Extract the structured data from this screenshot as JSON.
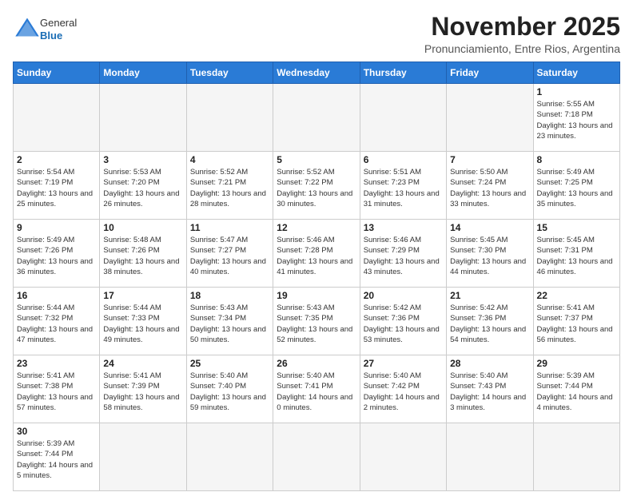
{
  "header": {
    "logo_general": "General",
    "logo_blue": "Blue",
    "month": "November 2025",
    "location": "Pronunciamiento, Entre Rios, Argentina"
  },
  "days_of_week": [
    "Sunday",
    "Monday",
    "Tuesday",
    "Wednesday",
    "Thursday",
    "Friday",
    "Saturday"
  ],
  "weeks": [
    [
      {
        "day": "",
        "info": ""
      },
      {
        "day": "",
        "info": ""
      },
      {
        "day": "",
        "info": ""
      },
      {
        "day": "",
        "info": ""
      },
      {
        "day": "",
        "info": ""
      },
      {
        "day": "",
        "info": ""
      },
      {
        "day": "1",
        "info": "Sunrise: 5:55 AM\nSunset: 7:18 PM\nDaylight: 13 hours\nand 23 minutes."
      }
    ],
    [
      {
        "day": "2",
        "info": "Sunrise: 5:54 AM\nSunset: 7:19 PM\nDaylight: 13 hours\nand 25 minutes."
      },
      {
        "day": "3",
        "info": "Sunrise: 5:53 AM\nSunset: 7:20 PM\nDaylight: 13 hours\nand 26 minutes."
      },
      {
        "day": "4",
        "info": "Sunrise: 5:52 AM\nSunset: 7:21 PM\nDaylight: 13 hours\nand 28 minutes."
      },
      {
        "day": "5",
        "info": "Sunrise: 5:52 AM\nSunset: 7:22 PM\nDaylight: 13 hours\nand 30 minutes."
      },
      {
        "day": "6",
        "info": "Sunrise: 5:51 AM\nSunset: 7:23 PM\nDaylight: 13 hours\nand 31 minutes."
      },
      {
        "day": "7",
        "info": "Sunrise: 5:50 AM\nSunset: 7:24 PM\nDaylight: 13 hours\nand 33 minutes."
      },
      {
        "day": "8",
        "info": "Sunrise: 5:49 AM\nSunset: 7:25 PM\nDaylight: 13 hours\nand 35 minutes."
      }
    ],
    [
      {
        "day": "9",
        "info": "Sunrise: 5:49 AM\nSunset: 7:26 PM\nDaylight: 13 hours\nand 36 minutes."
      },
      {
        "day": "10",
        "info": "Sunrise: 5:48 AM\nSunset: 7:26 PM\nDaylight: 13 hours\nand 38 minutes."
      },
      {
        "day": "11",
        "info": "Sunrise: 5:47 AM\nSunset: 7:27 PM\nDaylight: 13 hours\nand 40 minutes."
      },
      {
        "day": "12",
        "info": "Sunrise: 5:46 AM\nSunset: 7:28 PM\nDaylight: 13 hours\nand 41 minutes."
      },
      {
        "day": "13",
        "info": "Sunrise: 5:46 AM\nSunset: 7:29 PM\nDaylight: 13 hours\nand 43 minutes."
      },
      {
        "day": "14",
        "info": "Sunrise: 5:45 AM\nSunset: 7:30 PM\nDaylight: 13 hours\nand 44 minutes."
      },
      {
        "day": "15",
        "info": "Sunrise: 5:45 AM\nSunset: 7:31 PM\nDaylight: 13 hours\nand 46 minutes."
      }
    ],
    [
      {
        "day": "16",
        "info": "Sunrise: 5:44 AM\nSunset: 7:32 PM\nDaylight: 13 hours\nand 47 minutes."
      },
      {
        "day": "17",
        "info": "Sunrise: 5:44 AM\nSunset: 7:33 PM\nDaylight: 13 hours\nand 49 minutes."
      },
      {
        "day": "18",
        "info": "Sunrise: 5:43 AM\nSunset: 7:34 PM\nDaylight: 13 hours\nand 50 minutes."
      },
      {
        "day": "19",
        "info": "Sunrise: 5:43 AM\nSunset: 7:35 PM\nDaylight: 13 hours\nand 52 minutes."
      },
      {
        "day": "20",
        "info": "Sunrise: 5:42 AM\nSunset: 7:36 PM\nDaylight: 13 hours\nand 53 minutes."
      },
      {
        "day": "21",
        "info": "Sunrise: 5:42 AM\nSunset: 7:36 PM\nDaylight: 13 hours\nand 54 minutes."
      },
      {
        "day": "22",
        "info": "Sunrise: 5:41 AM\nSunset: 7:37 PM\nDaylight: 13 hours\nand 56 minutes."
      }
    ],
    [
      {
        "day": "23",
        "info": "Sunrise: 5:41 AM\nSunset: 7:38 PM\nDaylight: 13 hours\nand 57 minutes."
      },
      {
        "day": "24",
        "info": "Sunrise: 5:41 AM\nSunset: 7:39 PM\nDaylight: 13 hours\nand 58 minutes."
      },
      {
        "day": "25",
        "info": "Sunrise: 5:40 AM\nSunset: 7:40 PM\nDaylight: 13 hours\nand 59 minutes."
      },
      {
        "day": "26",
        "info": "Sunrise: 5:40 AM\nSunset: 7:41 PM\nDaylight: 14 hours\nand 0 minutes."
      },
      {
        "day": "27",
        "info": "Sunrise: 5:40 AM\nSunset: 7:42 PM\nDaylight: 14 hours\nand 2 minutes."
      },
      {
        "day": "28",
        "info": "Sunrise: 5:40 AM\nSunset: 7:43 PM\nDaylight: 14 hours\nand 3 minutes."
      },
      {
        "day": "29",
        "info": "Sunrise: 5:39 AM\nSunset: 7:44 PM\nDaylight: 14 hours\nand 4 minutes."
      }
    ],
    [
      {
        "day": "30",
        "info": "Sunrise: 5:39 AM\nSunset: 7:44 PM\nDaylight: 14 hours\nand 5 minutes."
      },
      {
        "day": "",
        "info": ""
      },
      {
        "day": "",
        "info": ""
      },
      {
        "day": "",
        "info": ""
      },
      {
        "day": "",
        "info": ""
      },
      {
        "day": "",
        "info": ""
      },
      {
        "day": "",
        "info": ""
      }
    ]
  ]
}
